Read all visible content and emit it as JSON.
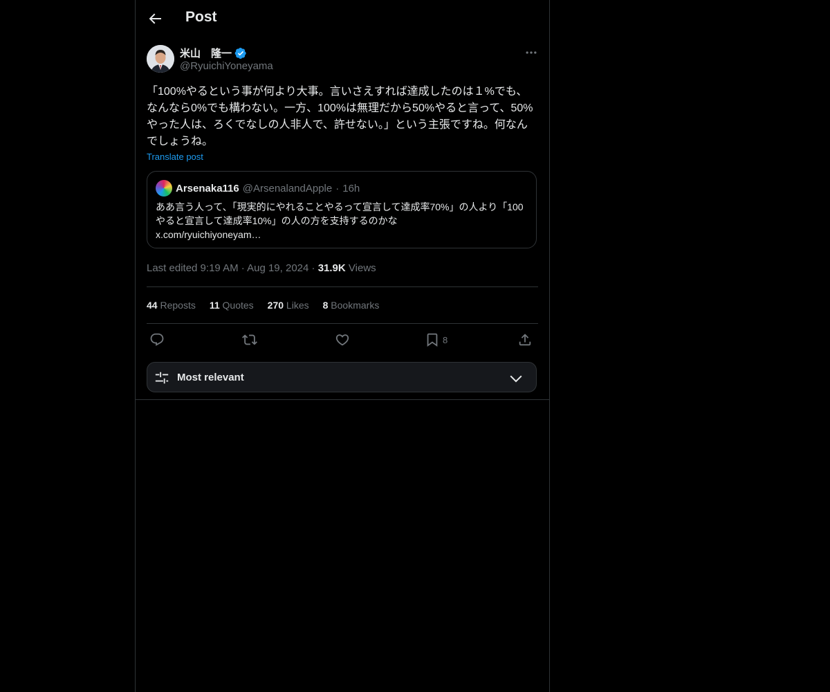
{
  "header": {
    "title": "Post"
  },
  "author": {
    "name": "米山　隆一",
    "handle": "@RyuichiYoneyama",
    "verified_color": "#1d9bf0"
  },
  "tweet": {
    "text": "「100%やるという事が何より大事。言いさえすれば達成したのは１%でも、なんなら0%でも構わない。一方、100%は無理だから50%やると言って、50%やった人は、ろくでなしの人非人で、許せない。」という主張ですね。何なんでしょうね。",
    "translate": "Translate post"
  },
  "quote": {
    "name": "Arsenaka116",
    "handle": "@ArsenalandApple",
    "dot": "·",
    "time": "16h",
    "text": "ああ言う人って、「現実的にやれることやるって宣言して達成率70%」の人より「100やると宣言して達成率10%」の人の方を支持するのかな\nx.com/ryuichiyoneyam…"
  },
  "meta": {
    "edited": "Last edited 9:19 AM",
    "sep": "·",
    "date": "Aug 19, 2024",
    "views_count": "31.9K",
    "views_label": "Views"
  },
  "stats": [
    {
      "count": "44",
      "label": "Reposts"
    },
    {
      "count": "11",
      "label": "Quotes"
    },
    {
      "count": "270",
      "label": "Likes"
    },
    {
      "count": "8",
      "label": "Bookmarks"
    }
  ],
  "actions": {
    "bookmark_count": "8"
  },
  "sort": {
    "label": "Most relevant"
  },
  "colors": {
    "background": "#000000",
    "accent": "#1d9bf0",
    "text": "#e7e9ea",
    "muted": "#71767b",
    "border": "#2f3336"
  }
}
